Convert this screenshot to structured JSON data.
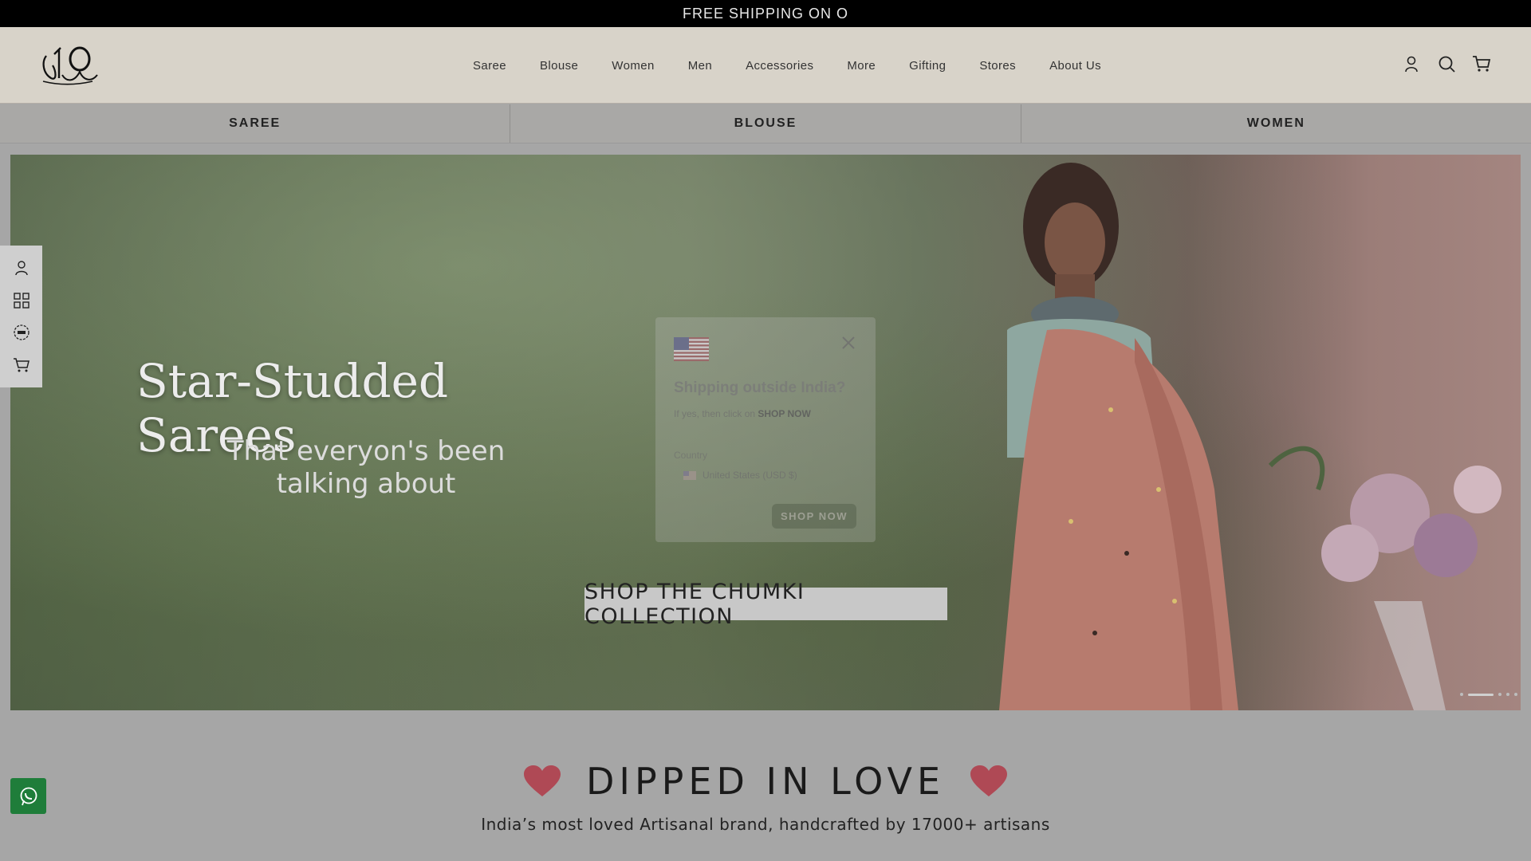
{
  "announcement": {
    "text": "FREE SHIPPING ON O"
  },
  "header": {
    "logo_alt": "Suta",
    "nav": [
      {
        "label": "Saree"
      },
      {
        "label": "Blouse"
      },
      {
        "label": "Women"
      },
      {
        "label": "Men"
      },
      {
        "label": "Accessories"
      },
      {
        "label": "More"
      },
      {
        "label": "Gifting"
      },
      {
        "label": "Stores"
      },
      {
        "label": "About Us"
      }
    ],
    "icons": [
      "account-icon",
      "search-icon",
      "cart-icon"
    ]
  },
  "category_strip": [
    {
      "label": "SAREE"
    },
    {
      "label": "BLOUSE"
    },
    {
      "label": "WOMEN"
    }
  ],
  "hero": {
    "title": "Star-Studded Sarees",
    "subtitle_line1": "That everyon's been",
    "subtitle_line2": "talking about",
    "cta": "SHOP THE CHUMKI COLLECTION",
    "slide_count": 5,
    "active_slide": 2
  },
  "modal": {
    "title": "Shipping outside India?",
    "hint_prefix": "If yes, then click on ",
    "hint_strong": "SHOP NOW",
    "country_label": "Country",
    "country_value": "United States (USD $)",
    "button": "SHOP NOW"
  },
  "side_rail": {
    "icons": [
      "account-icon",
      "categories-grid-icon",
      "new-badge-icon",
      "cart-icon"
    ]
  },
  "section": {
    "title": "DIPPED IN LOVE",
    "subtitle": "India’s most loved Artisanal brand, handcrafted by 17000+ artisans"
  },
  "colors": {
    "announce_bg": "#000000",
    "header_bg": "#d8d3c9",
    "whatsapp_green": "#1f7d3a",
    "heart_red": "#b22a3a"
  }
}
